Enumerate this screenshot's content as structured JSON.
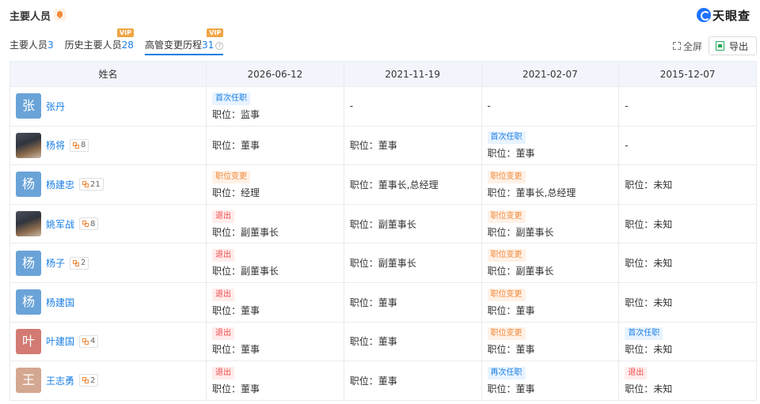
{
  "header": {
    "title": "主要人员",
    "logo": "天眼查"
  },
  "tabs": [
    {
      "label": "主要人员",
      "count": "3",
      "vip": ""
    },
    {
      "label": "历史主要人员",
      "count": "28",
      "vip": "VIP"
    },
    {
      "label": "高管变更历程",
      "count": "31",
      "vip": "VIP",
      "help": "?"
    }
  ],
  "tools": {
    "fullscreen": "全屏",
    "export": "导出"
  },
  "table": {
    "headers": [
      "姓名",
      "2026-06-12",
      "2021-11-19",
      "2021-02-07",
      "2015-12-07"
    ],
    "rows": [
      {
        "name": "张丹",
        "initial": "张",
        "color": "#6aa3d8",
        "photo": false,
        "rel": "",
        "cells": [
          {
            "tag": "首次任职",
            "type": "first",
            "pos": "职位：监事"
          },
          {
            "tag": "",
            "pos": "-"
          },
          {
            "tag": "",
            "pos": "-"
          },
          {
            "tag": "",
            "pos": "-"
          }
        ]
      },
      {
        "name": "杨将",
        "initial": "",
        "color": "",
        "photo": true,
        "rel": "8",
        "cells": [
          {
            "tag": "",
            "pos": "职位：董事"
          },
          {
            "tag": "",
            "pos": "职位：董事"
          },
          {
            "tag": "首次任职",
            "type": "first",
            "pos": "职位：董事"
          },
          {
            "tag": "",
            "pos": "-"
          }
        ]
      },
      {
        "name": "杨建忠",
        "initial": "杨",
        "color": "#6aa3d8",
        "photo": false,
        "rel": "21",
        "cells": [
          {
            "tag": "职位变更",
            "type": "change",
            "pos": "职位：经理"
          },
          {
            "tag": "",
            "pos": "职位：董事长,总经理"
          },
          {
            "tag": "职位变更",
            "type": "change",
            "pos": "职位：董事长,总经理"
          },
          {
            "tag": "",
            "pos": "职位：未知"
          }
        ]
      },
      {
        "name": "姚军战",
        "initial": "",
        "color": "",
        "photo": true,
        "rel": "8",
        "cells": [
          {
            "tag": "退出",
            "type": "exit",
            "pos": "职位：副董事长"
          },
          {
            "tag": "",
            "pos": "职位：副董事长"
          },
          {
            "tag": "职位变更",
            "type": "change",
            "pos": "职位：副董事长"
          },
          {
            "tag": "",
            "pos": "职位：未知"
          }
        ]
      },
      {
        "name": "杨子",
        "initial": "杨",
        "color": "#6aa3d8",
        "photo": false,
        "rel": "2",
        "cells": [
          {
            "tag": "退出",
            "type": "exit",
            "pos": "职位：副董事长"
          },
          {
            "tag": "",
            "pos": "职位：副董事长"
          },
          {
            "tag": "职位变更",
            "type": "change",
            "pos": "职位：副董事长"
          },
          {
            "tag": "",
            "pos": "职位：未知"
          }
        ]
      },
      {
        "name": "杨建国",
        "initial": "杨",
        "color": "#6aa3d8",
        "photo": false,
        "rel": "",
        "cells": [
          {
            "tag": "退出",
            "type": "exit",
            "pos": "职位：董事"
          },
          {
            "tag": "",
            "pos": "职位：董事"
          },
          {
            "tag": "职位变更",
            "type": "change",
            "pos": "职位：董事"
          },
          {
            "tag": "",
            "pos": "职位：未知"
          }
        ]
      },
      {
        "name": "叶建国",
        "initial": "叶",
        "color": "#d27a73",
        "photo": false,
        "rel": "4",
        "cells": [
          {
            "tag": "退出",
            "type": "exit",
            "pos": "职位：董事"
          },
          {
            "tag": "",
            "pos": "职位：董事"
          },
          {
            "tag": "职位变更",
            "type": "change",
            "pos": "职位：董事"
          },
          {
            "tag": "首次任职",
            "type": "first",
            "pos": "职位：未知"
          }
        ]
      },
      {
        "name": "王志勇",
        "initial": "王",
        "color": "#d4a791",
        "photo": false,
        "rel": "2",
        "cells": [
          {
            "tag": "退出",
            "type": "exit",
            "pos": "职位：董事"
          },
          {
            "tag": "",
            "pos": "职位：董事"
          },
          {
            "tag": "再次任职",
            "type": "second",
            "pos": "职位：董事"
          },
          {
            "tag": "退出",
            "type": "exit",
            "pos": "职位：未知"
          }
        ]
      }
    ]
  }
}
